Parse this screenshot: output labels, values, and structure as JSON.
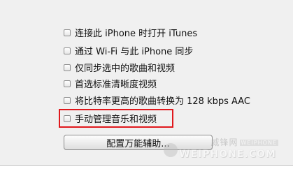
{
  "options": [
    {
      "label": "连接此 iPhone 时打开 iTunes",
      "checked": false
    },
    {
      "label": "通过 Wi-Fi 与此 iPhone 同步",
      "checked": false
    },
    {
      "label": "仅同步选中的歌曲和视频",
      "checked": false
    },
    {
      "label": "首选标准清晰度视频",
      "checked": false
    },
    {
      "label": "将比特率更高的歌曲转换为 128 kbps AAC",
      "checked": false
    },
    {
      "label": "手动管理音乐和视频",
      "checked": false
    }
  ],
  "accessibility_button": "配置万能辅助...",
  "watermark": {
    "top": "威锋网",
    "tag": "WEIPHONE",
    "bottom": "WEIPHONE.COM"
  },
  "colors": {
    "highlight": "#e0181c",
    "panel": "#f0f0f0"
  }
}
